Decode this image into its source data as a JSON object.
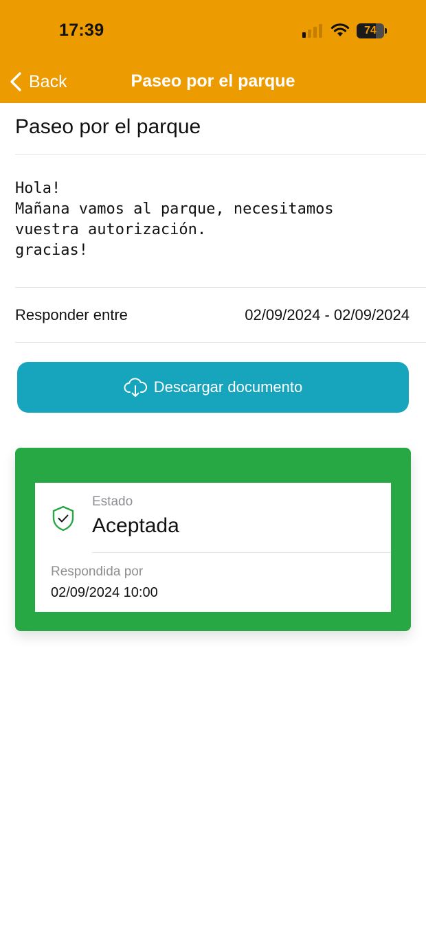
{
  "status_bar": {
    "time": "17:39",
    "battery": "74",
    "icons": [
      "signal-icon",
      "wifi-icon",
      "battery-icon"
    ]
  },
  "nav": {
    "back_label": "Back",
    "title": "Paseo por el parque"
  },
  "page": {
    "heading": "Paseo por el parque",
    "message": "Hola!\nMañana vamos al parque, necesitamos\nvuestra autorización.\ngracias!",
    "respond_label": "Responder entre",
    "respond_range": "02/09/2024 - 02/09/2024"
  },
  "download": {
    "label": "Descargar documento",
    "icon": "cloud-download-icon"
  },
  "status": {
    "label": "Estado",
    "value": "Aceptada",
    "icon": "shield-check-icon",
    "responded_label": "Respondida por",
    "responded_value": "02/09/2024 10:00"
  },
  "colors": {
    "header": "#EC9C00",
    "download_button": "#17A5BE",
    "accepted": "#28A745"
  }
}
